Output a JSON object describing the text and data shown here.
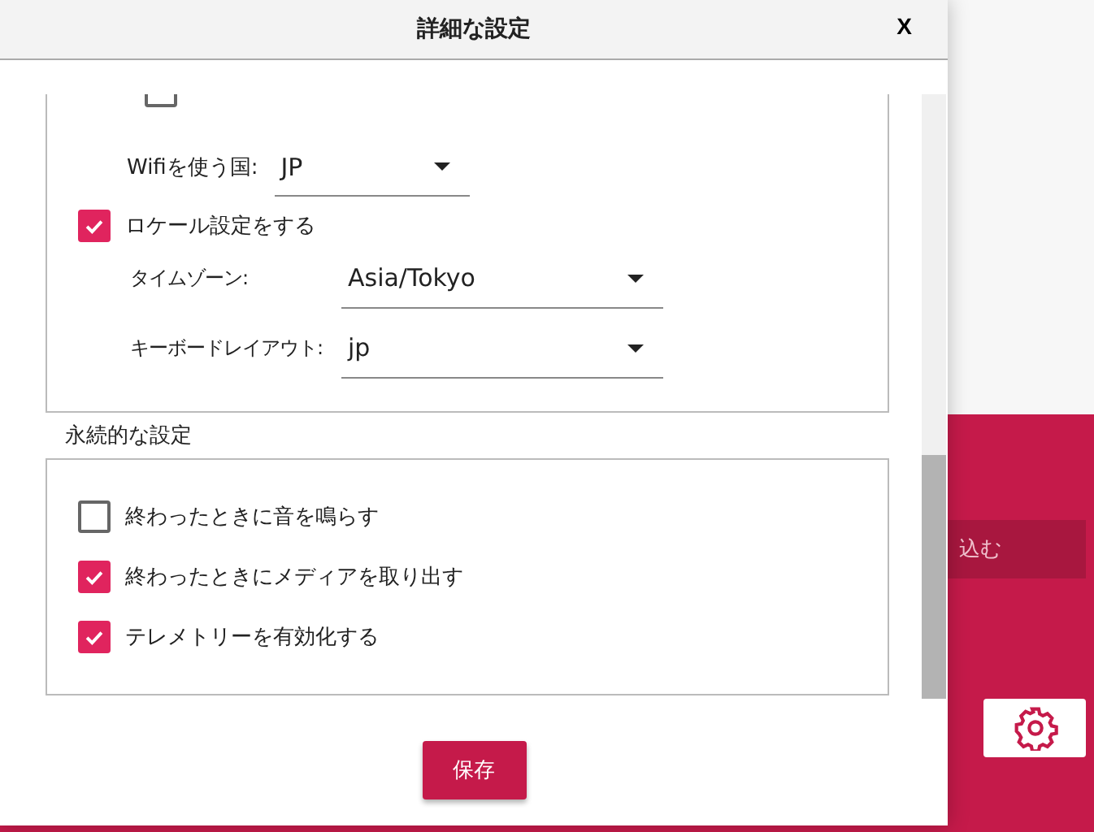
{
  "background": {
    "write_button": {
      "label": "込む"
    }
  },
  "dialog": {
    "title": "詳細な設定",
    "close": "X",
    "hidden_row": {
      "checked": false
    },
    "wifi_country": {
      "label": "Wifiを使う国:",
      "value": "JP"
    },
    "locale": {
      "label": "ロケール設定をする",
      "checked": true
    },
    "locale_fields": [
      {
        "label": "タイムゾーン:",
        "value": "Asia/Tokyo"
      },
      {
        "label": "キーボードレイアウト:",
        "value": "jp"
      }
    ],
    "persistent": {
      "title": "永続的な設定",
      "options": [
        {
          "label": "終わったときに音を鳴らす",
          "checked": false
        },
        {
          "label": "終わったときにメディアを取り出す",
          "checked": true
        },
        {
          "label": "テレメトリーを有効化する",
          "checked": true
        }
      ]
    },
    "save": "保存"
  }
}
